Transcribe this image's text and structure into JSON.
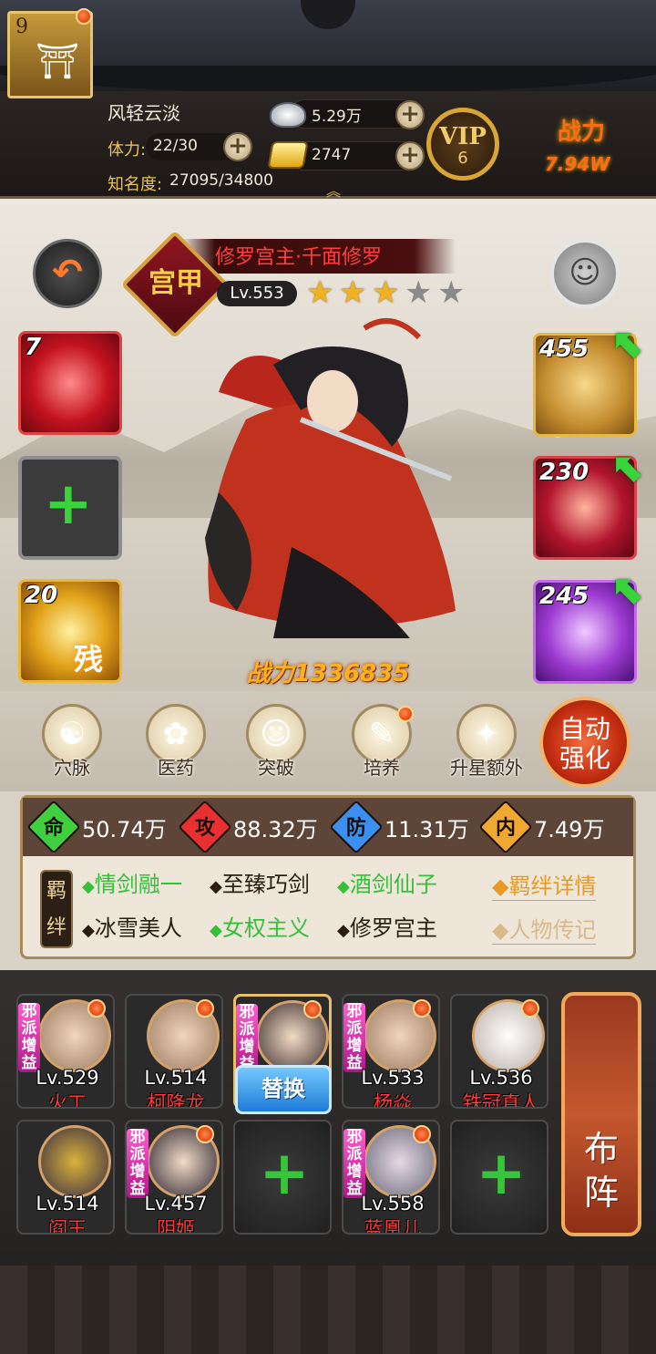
{
  "player": {
    "avatar_level": "9",
    "name": "风轻云淡",
    "stamina_label": "体力:",
    "stamina_value": "22/30",
    "fame_label": "知名度:",
    "fame_value": "27095/34800",
    "silver": "5.29万",
    "gold": "2747",
    "vip_label": "VIP",
    "vip_level": "6",
    "power_label": "战力",
    "power_value": "7.94W"
  },
  "hero": {
    "rank": "宫甲",
    "title": "修罗宫主·千面修罗",
    "level": "Lv.553",
    "stars_total": 5,
    "stars_filled": 3,
    "power": "战力1336835"
  },
  "left_slots": [
    {
      "count": "7",
      "name": "red-heart-skill"
    },
    {
      "count": "",
      "name": "empty-slot"
    },
    {
      "count": "20",
      "name": "gold-rose-skill",
      "tag": "残"
    }
  ],
  "right_slots": [
    {
      "count": "455",
      "name": "weapon-sword"
    },
    {
      "count": "230",
      "name": "armor"
    },
    {
      "count": "245",
      "name": "teapot-accessory"
    }
  ],
  "functions": [
    {
      "label": "穴脉",
      "icon": "meridian-icon"
    },
    {
      "label": "医药",
      "icon": "medicine-icon"
    },
    {
      "label": "突破",
      "icon": "breakthrough-icon"
    },
    {
      "label": "培养",
      "icon": "cultivate-icon"
    },
    {
      "label": "升星额外",
      "icon": "star-up-icon"
    }
  ],
  "auto_button": {
    "line1": "自动",
    "line2": "强化"
  },
  "stats": [
    {
      "glyph": "命",
      "value": "50.74万",
      "color": "#3fcf3f"
    },
    {
      "glyph": "攻",
      "value": "88.32万",
      "color": "#e83030"
    },
    {
      "glyph": "防",
      "value": "11.31万",
      "color": "#3b8ff0"
    },
    {
      "glyph": "内",
      "value": "7.49万",
      "color": "#f0a930"
    }
  ],
  "bonds": {
    "seal_text": "羁绊",
    "row1": [
      {
        "text": "情剑融一",
        "active": true
      },
      {
        "text": "至臻巧剑",
        "active": false
      },
      {
        "text": "酒剑仙子",
        "active": true
      }
    ],
    "row2": [
      {
        "text": "冰雪美人",
        "active": false
      },
      {
        "text": "女权主义",
        "active": true
      },
      {
        "text": "修罗宫主",
        "active": false
      }
    ],
    "detail_link": "◆羁绊详情",
    "bio_link": "◆人物传记"
  },
  "team": {
    "tag_text": "邪派增益",
    "replace_label": "替换",
    "formation_label": "布阵",
    "members": [
      {
        "level": "Lv.529",
        "name": "火工"
      },
      {
        "level": "Lv.514",
        "name": "柯降龙"
      },
      {
        "level": "",
        "name": ""
      },
      {
        "level": "Lv.533",
        "name": "杨焱"
      },
      {
        "level": "Lv.536",
        "name": "铁冠真人"
      },
      {
        "level": "Lv.514",
        "name": "阎王"
      },
      {
        "level": "Lv.457",
        "name": "阴姬"
      },
      {
        "level": "",
        "name": ""
      },
      {
        "level": "Lv.558",
        "name": "蓝凰儿"
      },
      {
        "level": "",
        "name": ""
      }
    ]
  }
}
